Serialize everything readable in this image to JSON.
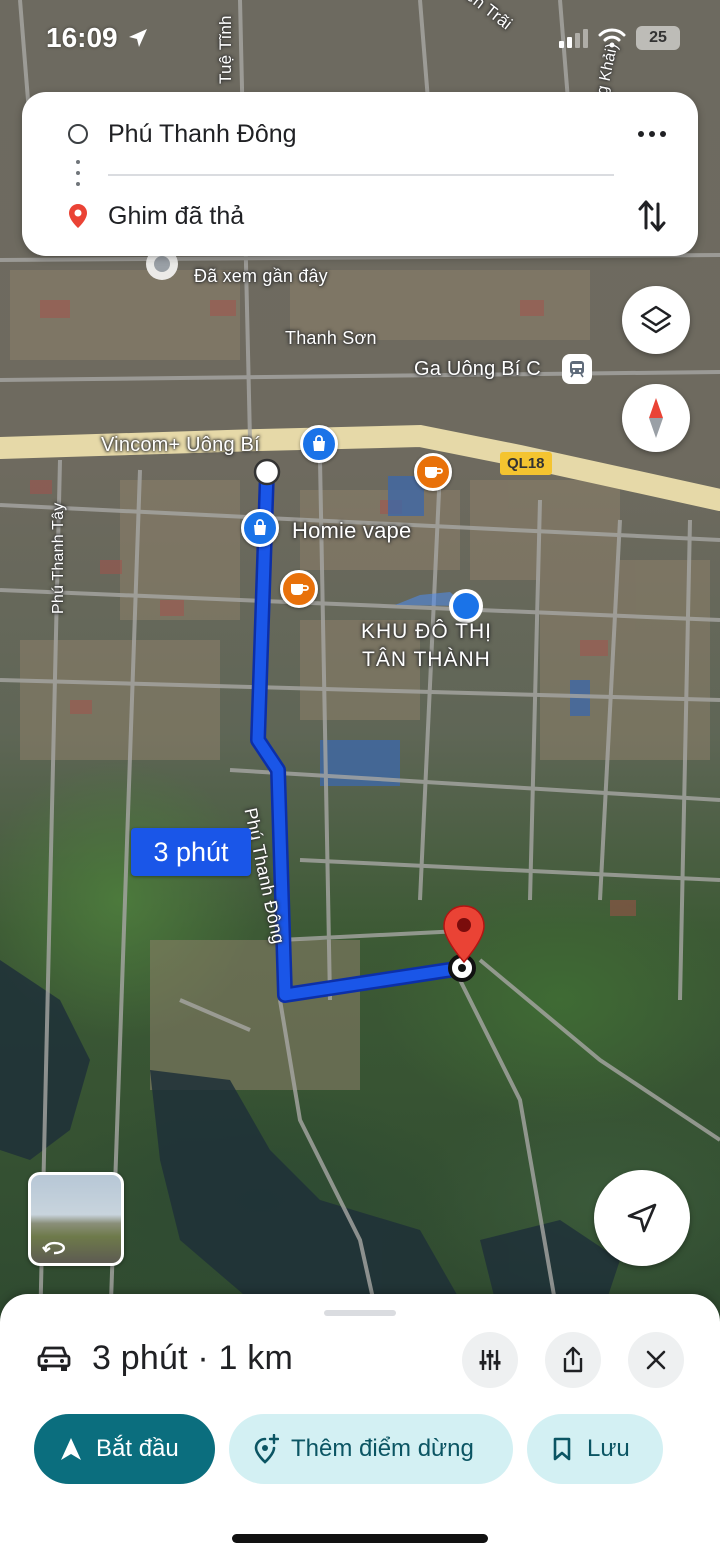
{
  "status_bar": {
    "time": "16:09",
    "battery": "25",
    "icons": [
      "location-arrow-icon",
      "signal-icon",
      "wifi-icon",
      "battery-icon"
    ]
  },
  "directions": {
    "origin": "Phú Thanh Đông",
    "destination": "Ghim đã thả",
    "icons": [
      "origin-circle-icon",
      "destination-pin-icon",
      "more-icon",
      "swap-icon"
    ]
  },
  "map": {
    "labels": {
      "tue_tinh": "Tuệ Tĩnh",
      "nguyen_trai": "ễn Trãi",
      "khai": "g Khải)",
      "recently_viewed": "Đã xem gần đây",
      "thanh_son": "Thanh Sơn",
      "station": "Ga Uông Bí C",
      "vincom": "Vincom+ Uông Bí",
      "ql18": "QL18",
      "homie": "Homie vape",
      "phu_thanh_tay": "Phú Thanh Tây",
      "district_line1": "KHU ĐÔ THỊ",
      "district_line2": "TÂN THÀNH",
      "route_street": "Phú Thanh Đông"
    },
    "route_duration": "3 phút",
    "route_color": "#1a56e8",
    "icons": [
      "layers-icon",
      "compass-icon",
      "my-location-icon",
      "shopping-bag-icon",
      "cafe-icon",
      "train-icon",
      "red-pin-icon"
    ]
  },
  "sheet": {
    "summary": "3 phút · 1 km",
    "start_label": "Bắt đầu",
    "add_stop_label": "Thêm điểm dừng",
    "save_label": "Lưu",
    "icons": [
      "car-icon",
      "route-options-icon",
      "share-icon",
      "close-icon",
      "navigation-arrow-icon",
      "add-place-icon",
      "bookmark-icon"
    ]
  },
  "colors": {
    "start_button": "#0b6e7e",
    "secondary_button": "#d3f0f3",
    "route": "#1a56e8"
  }
}
